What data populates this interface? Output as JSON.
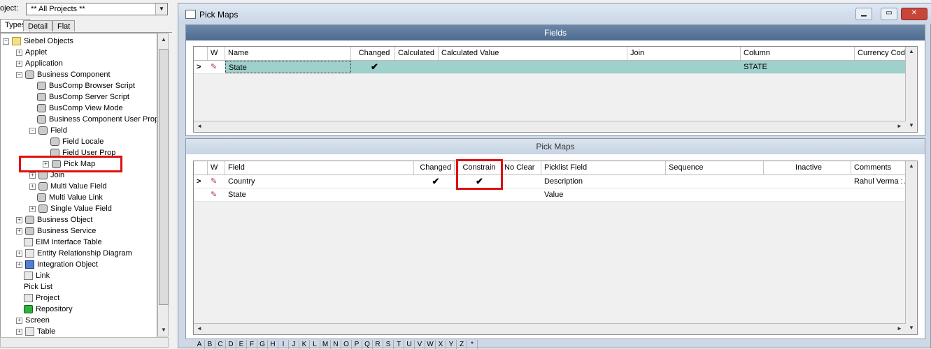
{
  "left_pane": {
    "object_label": "oject:",
    "object_value": "** All Projects **",
    "tabs": [
      "Types",
      "Detail",
      "Flat"
    ],
    "tree": [
      {
        "label": "Siebel Objects",
        "level": 0,
        "expander": "-",
        "icon": "folder-icon"
      },
      {
        "label": "Applet",
        "level": 1,
        "expander": "+",
        "icon": "window-icon"
      },
      {
        "label": "Application",
        "level": 1,
        "expander": "+",
        "icon": "application-icon"
      },
      {
        "label": "Business Component",
        "level": 1,
        "expander": "-",
        "icon": "gear-icon"
      },
      {
        "label": "BusComp Browser Script",
        "level": 2,
        "expander": "",
        "icon": "gear-icon"
      },
      {
        "label": "BusComp Server Script",
        "level": 2,
        "expander": "",
        "icon": "gear-icon"
      },
      {
        "label": "BusComp View Mode",
        "level": 2,
        "expander": "",
        "icon": "gear-icon"
      },
      {
        "label": "Business Component User Prop",
        "level": 2,
        "expander": "",
        "icon": "gear-icon"
      },
      {
        "label": "Field",
        "level": 2,
        "expander": "-",
        "icon": "gear-icon"
      },
      {
        "label": "Field Locale",
        "level": 3,
        "expander": "",
        "icon": "gear-icon"
      },
      {
        "label": "Field User Prop",
        "level": 3,
        "expander": "",
        "icon": "gear-icon"
      },
      {
        "label": "Pick Map",
        "level": 3,
        "expander": "+",
        "icon": "gear-icon"
      },
      {
        "label": "Join",
        "level": 2,
        "expander": "+",
        "icon": "gear-icon"
      },
      {
        "label": "Multi Value Field",
        "level": 2,
        "expander": "+",
        "icon": "gear-icon"
      },
      {
        "label": "Multi Value Link",
        "level": 2,
        "expander": "",
        "icon": "gear-icon"
      },
      {
        "label": "Single Value Field",
        "level": 2,
        "expander": "+",
        "icon": "gear-icon"
      },
      {
        "label": "Business Object",
        "level": 1,
        "expander": "+",
        "icon": "gear-icon"
      },
      {
        "label": "Business Service",
        "level": 1,
        "expander": "+",
        "icon": "service-icon"
      },
      {
        "label": "EIM Interface Table",
        "level": 1,
        "expander": "",
        "icon": "table-icon"
      },
      {
        "label": "Entity Relationship Diagram",
        "level": 1,
        "expander": "+",
        "icon": "diagram-icon"
      },
      {
        "label": "Integration Object",
        "level": 1,
        "expander": "+",
        "icon": "integration-icon"
      },
      {
        "label": "Link",
        "level": 1,
        "expander": "",
        "icon": "link-icon"
      },
      {
        "label": "Pick List",
        "level": 1,
        "expander": "",
        "icon": "window-icon"
      },
      {
        "label": "Project",
        "level": 1,
        "expander": "",
        "icon": "project-icon"
      },
      {
        "label": "Repository",
        "level": 1,
        "expander": "",
        "icon": "repository-icon"
      },
      {
        "label": "Screen",
        "level": 1,
        "expander": "+",
        "icon": "window-icon"
      },
      {
        "label": "Table",
        "level": 1,
        "expander": "+",
        "icon": "table-icon"
      }
    ]
  },
  "window": {
    "title": "Pick Maps",
    "fields": {
      "header": "Fields",
      "columns": [
        "W",
        "Name",
        "Changed",
        "Calculated",
        "Calculated Value",
        "Join",
        "Column",
        "Currency Code"
      ],
      "rows": [
        {
          "marker": ">",
          "name": "State",
          "changed": "✔",
          "calculated": "",
          "calc_value": "",
          "join": "",
          "column": "STATE",
          "currency": ""
        }
      ]
    },
    "pick_maps": {
      "header": "Pick Maps",
      "columns": [
        "W",
        "Field",
        "Changed",
        "Constrain",
        "No Clear",
        "Picklist Field",
        "Sequence",
        "Inactive",
        "Comments"
      ],
      "rows": [
        {
          "marker": ">",
          "field": "Country",
          "changed": "✔",
          "constrain": "✔",
          "noclear": "",
          "picklist": "Description",
          "sequence": "",
          "inactive": "",
          "comments": "Rahul Verma : A"
        },
        {
          "marker": "",
          "field": "State",
          "changed": "",
          "constrain": "",
          "noclear": "",
          "picklist": "Value",
          "sequence": "",
          "inactive": "",
          "comments": ""
        }
      ]
    },
    "alphabet": [
      "A",
      "B",
      "C",
      "D",
      "E",
      "F",
      "G",
      "H",
      "I",
      "J",
      "K",
      "L",
      "M",
      "N",
      "O",
      "P",
      "Q",
      "R",
      "S",
      "T",
      "U",
      "V",
      "W",
      "X",
      "Y",
      "Z",
      "*"
    ]
  },
  "colors": {
    "highlight": "#e01010",
    "selected_row": "#9ed0cc",
    "header_dark": "#4d6b90"
  }
}
